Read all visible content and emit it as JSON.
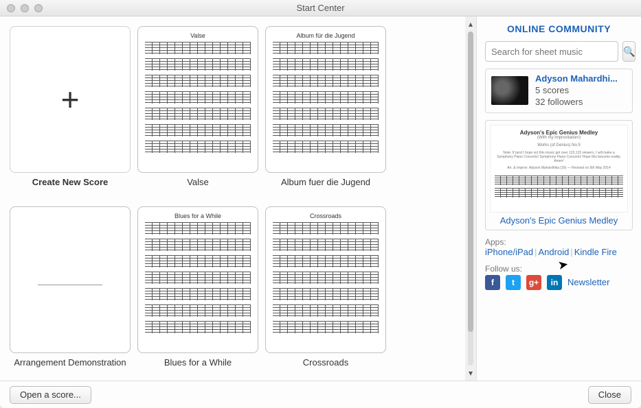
{
  "window": {
    "title": "Start Center"
  },
  "grid": {
    "items": [
      {
        "label": "Create New Score",
        "kind": "new"
      },
      {
        "label": "Valse",
        "kind": "score",
        "sheet_title": "Valse"
      },
      {
        "label": "Album fuer die Jugend",
        "kind": "score",
        "sheet_title": "Album für die Jugend"
      },
      {
        "label": "Arrangement Demonstration",
        "kind": "score",
        "sheet_title": ""
      },
      {
        "label": "Blues for a While",
        "kind": "score",
        "sheet_title": "Blues for a While"
      },
      {
        "label": "Crossroads",
        "kind": "score",
        "sheet_title": "Crossroads"
      }
    ]
  },
  "sidebar": {
    "heading": "ONLINE COMMUNITY",
    "search_placeholder": "Search for sheet music",
    "user": {
      "name": "Adyson Mahardhi...",
      "scores": "5 scores",
      "followers": "32 followers"
    },
    "featured": {
      "title": "Adyson's Epic Genius Medley",
      "subtitle": "(With my Improvitation!)",
      "meta1": "Works (of Genius) No.5",
      "meta2": "Note: If (and I hope so) this music get over 123,123 viewers, I will make a Symphony Piano Concerto! Symphony Piano Concerto! Hope this become reality. Amen!",
      "meta3": "Arr. & Improv: Adyson Mahardhika (16) — Revised on 5th May 2014",
      "link": "Adyson's Epic Genius Medley"
    },
    "apps_label": "Apps:",
    "apps": {
      "iphone": "iPhone/iPad",
      "android": "Android",
      "kindle": "Kindle Fire"
    },
    "follow_label": "Follow us:",
    "newsletter": "Newsletter"
  },
  "footer": {
    "open": "Open a score...",
    "close": "Close"
  }
}
